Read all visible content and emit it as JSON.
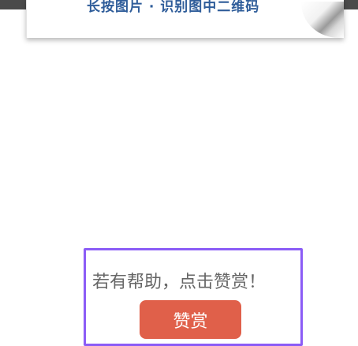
{
  "card": {
    "text": "长按图片 · 识别图中二维码"
  },
  "reward": {
    "prompt": "若有帮助，点击赞赏！",
    "button_label": "赞赏"
  },
  "colors": {
    "accent_border": "#8b5cf6",
    "button_bg": "#e0604a",
    "card_text": "#2f5d9a"
  }
}
